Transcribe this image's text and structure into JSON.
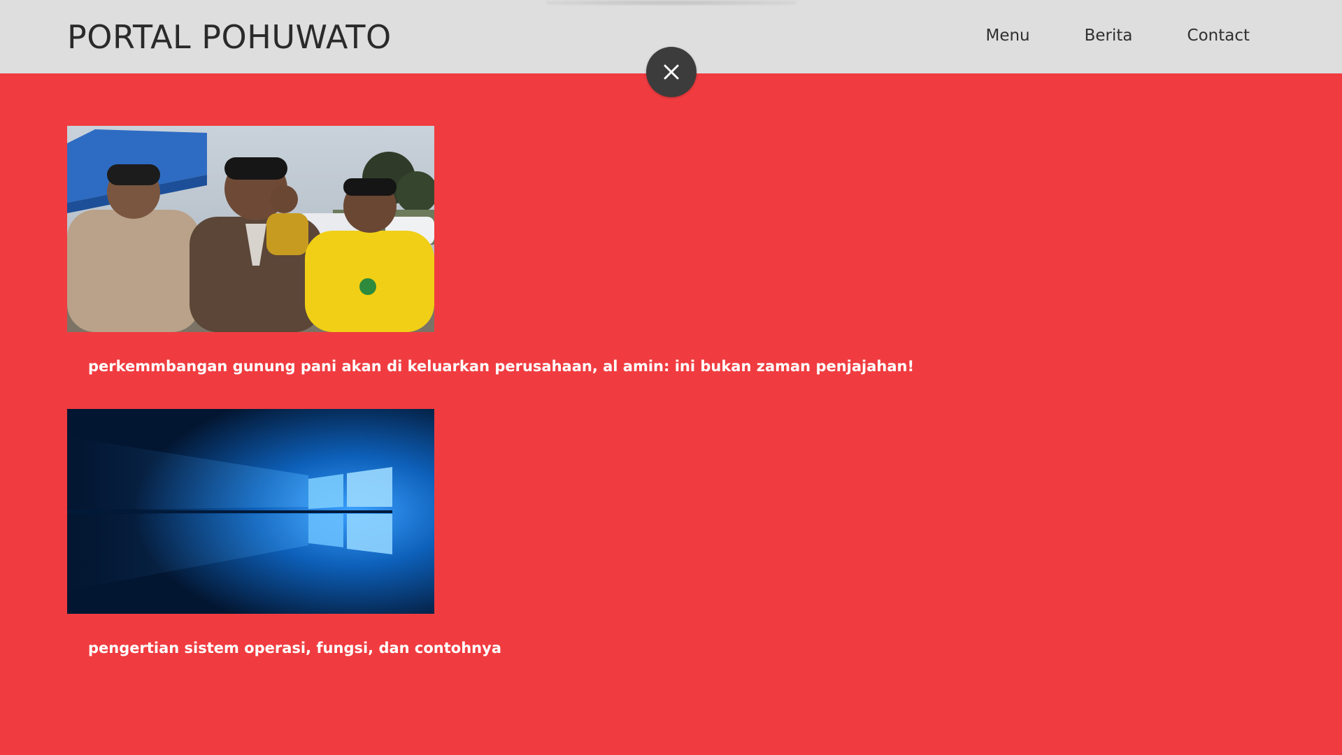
{
  "header": {
    "brand": "PORTAL POHUWATO",
    "nav": [
      {
        "label": "Menu"
      },
      {
        "label": "Berita"
      },
      {
        "label": "Contact"
      }
    ],
    "close_icon": "close-icon"
  },
  "articles": [
    {
      "title": "perkemmbangan gunung pani akan di keluarkan perusahaan, al amin: ini bukan zaman penjajahan!",
      "image": "photo-three-men"
    },
    {
      "title": "pengertian sistem operasi, fungsi, dan contohnya",
      "image": "windows-logo-wallpaper"
    }
  ],
  "colors": {
    "page_background": "#f03c40",
    "header_background": "#dedede",
    "close_button": "#3c3c3c"
  }
}
